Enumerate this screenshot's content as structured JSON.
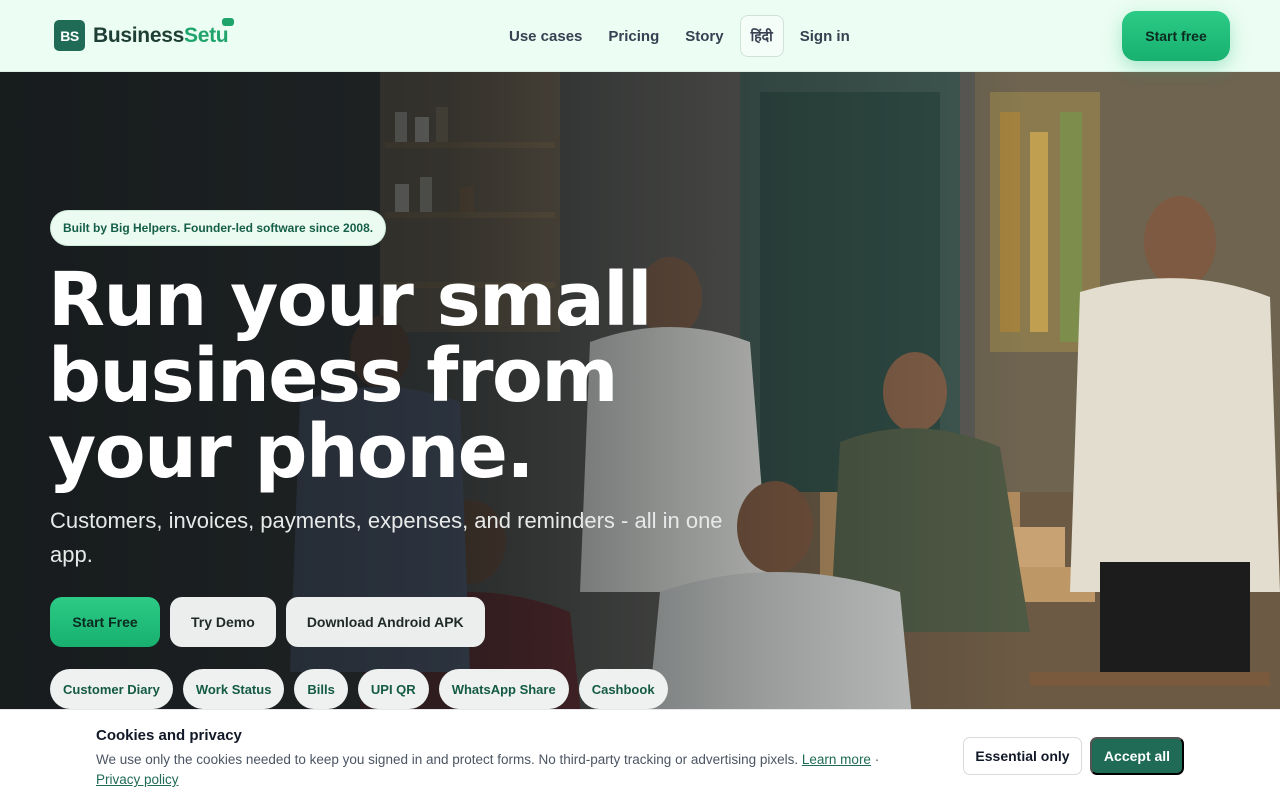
{
  "header": {
    "logo_mark": "BS",
    "logo_word_1": "Business",
    "logo_word_2": "Setu",
    "nav": [
      {
        "label": "Use cases"
      },
      {
        "label": "Pricing"
      },
      {
        "label": "Story"
      },
      {
        "label": "हिंदी"
      },
      {
        "label": "Sign in"
      }
    ],
    "cta_label": "Start free"
  },
  "hero": {
    "tag": "Built by Big Helpers. Founder-led software since 2008.",
    "headline": "Run your small business from your phone.",
    "subhead": "Customers, invoices, payments, expenses, and reminders - all in one app.",
    "buttons": {
      "start": "Start Free",
      "demo": "Try Demo",
      "apk": "Download Android APK"
    },
    "features": [
      "Customer Diary",
      "Work Status",
      "Bills",
      "UPI QR",
      "WhatsApp Share",
      "Cashbook"
    ]
  },
  "cookie": {
    "title": "Cookies and privacy",
    "text": "We use only the cookies needed to keep you signed in and protect forms. No third-party tracking or advertising pixels.",
    "learn_more": "Learn more",
    "separator": "·",
    "privacy": "Privacy policy",
    "essential": "Essential only",
    "accept": "Accept all"
  },
  "colors": {
    "brand": "#1f6b55",
    "accent": "#22c07c",
    "header_bg": "#ecfdf3"
  }
}
